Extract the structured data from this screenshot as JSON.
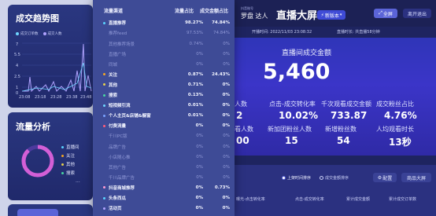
{
  "trend": {
    "title": "成交趋势图",
    "legend": [
      {
        "label": "成交订单数",
        "color": "#6fd6ff"
      },
      {
        "label": "成交人数",
        "color": "#b0a3ff"
      }
    ],
    "y_ticks": [
      "7",
      "5.5",
      "4",
      "2.5",
      "1",
      "0"
    ],
    "x_ticks": [
      "23:08",
      "23:18",
      "23:28",
      "23:38",
      "23:48"
    ]
  },
  "flow": {
    "title": "流量分析",
    "items": [
      "直播间",
      "关注",
      "其他",
      "搜索"
    ],
    "more": "···"
  },
  "dropdown": {
    "headers": {
      "name": "流量渠道",
      "c1": "流量占比",
      "c2": "成交金额占比"
    },
    "rows": [
      {
        "name": "直播推荐",
        "c1": "98.27%",
        "c2": "74.84%",
        "kind": "main",
        "color": "#5ad3ff"
      },
      {
        "name": "推荐feed",
        "c1": "97.53%",
        "c2": "74.84%",
        "kind": "sub"
      },
      {
        "name": "其他推荐场景",
        "c1": "0.74%",
        "c2": "0%",
        "kind": "sub"
      },
      {
        "name": "直播广场",
        "c1": "0%",
        "c2": "0%",
        "kind": "sub"
      },
      {
        "name": "同城",
        "c1": "0%",
        "c2": "0%",
        "kind": "sub"
      },
      {
        "name": "关注",
        "c1": "0.87%",
        "c2": "24.43%",
        "kind": "main",
        "color": "#f5a623"
      },
      {
        "name": "其他",
        "c1": "0.71%",
        "c2": "0%",
        "kind": "main",
        "color": "#e8d14a"
      },
      {
        "name": "搜索",
        "c1": "0.13%",
        "c2": "0%",
        "kind": "main",
        "color": "#47d7a0"
      },
      {
        "name": "短视频引流",
        "c1": "0.01%",
        "c2": "0%",
        "kind": "main",
        "color": "#6fd6ff"
      },
      {
        "name": "个人主页&店铺&橱窗",
        "c1": "0.01%",
        "c2": "0%",
        "kind": "main",
        "color": "#7aa2ff"
      },
      {
        "name": "付费流量",
        "c1": "0%",
        "c2": "0%",
        "kind": "main",
        "color": "#ff5d7a"
      },
      {
        "name": "千川PC版",
        "c1": "0%",
        "c2": "0%",
        "kind": "sub"
      },
      {
        "name": "品牌广告",
        "c1": "0%",
        "c2": "0%",
        "kind": "sub"
      },
      {
        "name": "小店随心推",
        "c1": "0%",
        "c2": "0%",
        "kind": "sub"
      },
      {
        "name": "其他广告",
        "c1": "0%",
        "c2": "0%",
        "kind": "sub"
      },
      {
        "name": "千川品牌广告",
        "c1": "0%",
        "c2": "0%",
        "kind": "sub"
      },
      {
        "name": "抖音商城推荐",
        "c1": "0%",
        "c2": "0.73%",
        "kind": "main",
        "color": "#ff9bd2"
      },
      {
        "name": "头条西瓜",
        "c1": "0%",
        "c2": "0%",
        "kind": "main",
        "color": "#5ad3ff"
      },
      {
        "name": "活动页",
        "c1": "0%",
        "c2": "0%",
        "kind": "main",
        "color": "#b0a3ff"
      }
    ]
  },
  "header": {
    "account_small": "抖音账号",
    "account": "罗盘 达人",
    "title": "直播大屏",
    "badge": "新版本",
    "fullscreen": "全屏",
    "exit": "离开退出",
    "start_time": "开播时间: 2022/11/03 23:08:32",
    "duration": "直播时长: 共直播58分钟"
  },
  "summary": {
    "title": "直播间成交金额",
    "value": "5,460",
    "metrics_row1": [
      {
        "label": "人数",
        "value": "2"
      },
      {
        "label": "点击-成交转化率",
        "value": "10.02%"
      },
      {
        "label": "千次观看成交金额",
        "value": "733.87"
      },
      {
        "label": "成交粉丝占比",
        "value": "4.76%"
      }
    ],
    "metrics_row2": [
      {
        "label": "看人数",
        "value": "00"
      },
      {
        "label": "新加团粉丝人数",
        "value": "15"
      },
      {
        "label": "新增粉丝数",
        "value": "54"
      },
      {
        "label": "人均观看时长",
        "value": "13秒"
      }
    ]
  },
  "table": {
    "radio1": "上架时间排序",
    "radio2": "成交金额排序",
    "btn1": "配置",
    "btn2": "商品大屏",
    "headers": [
      "曝光-点击转化率",
      "点击-成交转化率",
      "累计成交金额",
      "累计成交订单数"
    ]
  },
  "colors": {
    "accent": "#5b64d8",
    "panel": "#2a3780",
    "dropdown": "#3e4b96",
    "bg": "#cfd4ea"
  }
}
